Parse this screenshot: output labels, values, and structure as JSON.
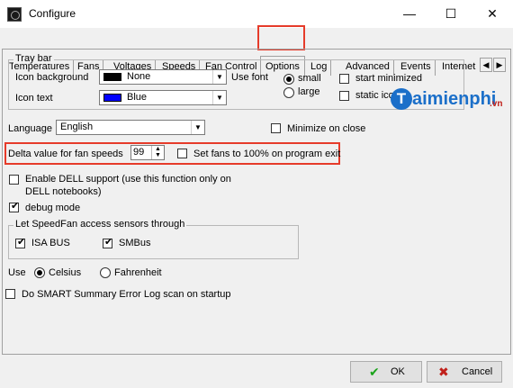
{
  "window": {
    "title": "Configure",
    "minimize": "—",
    "maximize": "☐",
    "close": "✕"
  },
  "tabs": [
    {
      "label": "Temperatures"
    },
    {
      "label": "Fans"
    },
    {
      "label": "Voltages"
    },
    {
      "label": "Speeds"
    },
    {
      "label": "Fan Control"
    },
    {
      "label": "Options"
    },
    {
      "label": "Log"
    },
    {
      "label": "Advanced"
    },
    {
      "label": "Events"
    },
    {
      "label": "Internet"
    }
  ],
  "active_tab": "Options",
  "tray_bar": {
    "group_label": "Tray bar",
    "icon_background_label": "Icon background",
    "icon_background_value": "None",
    "icon_background_color": "#000000",
    "icon_text_label": "Icon text",
    "icon_text_value": "Blue",
    "icon_text_color": "#0000ff",
    "use_font_label": "Use font",
    "font_small": "small",
    "font_large": "large",
    "start_minimized": "start minimized",
    "static_icon": "static ico"
  },
  "language": {
    "label": "Language",
    "value": "English"
  },
  "minimize_on_close": "Minimize on close",
  "delta": {
    "label": "Delta value for fan speeds",
    "value": "99"
  },
  "set_fans_100": "Set fans to 100% on program exit",
  "dell": {
    "line1": "Enable DELL support (use this function only on",
    "line2": "DELL notebooks)"
  },
  "debug_mode": "debug mode",
  "sensors": {
    "group_label": "Let SpeedFan access sensors through",
    "isa_bus": "ISA BUS",
    "smbus": "SMBus"
  },
  "units": {
    "label": "Use",
    "celsius": "Celsius",
    "fahrenheit": "Fahrenheit"
  },
  "smart": "Do SMART Summary Error Log scan on startup",
  "buttons": {
    "ok": "OK",
    "cancel": "Cancel",
    "ok_icon": "✔",
    "cancel_icon": "✖"
  },
  "watermark": {
    "brand": "aimienphi",
    "suffix": ".vn"
  },
  "colors": {
    "highlight": "#e63b2a",
    "ok_green": "#1aa31a",
    "cancel_red": "#c0201a",
    "brand_blue": "#1b6fc9"
  }
}
